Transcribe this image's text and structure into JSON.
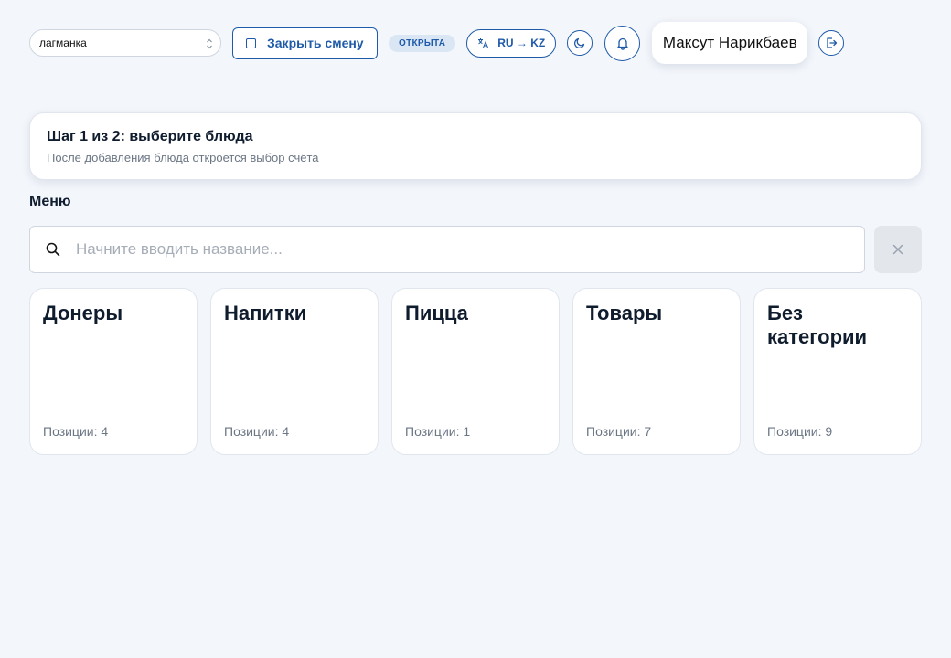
{
  "topbar": {
    "location_select": "лагманка",
    "close_shift_label": "Закрыть смену",
    "shift_status": "ОТКРЫТА",
    "language_label": "RU → KZ",
    "user_name": "Максут Нарикбаев"
  },
  "step": {
    "title": "Шаг 1 из 2: выберите блюда",
    "subtitle": "После добавления блюда откроется выбор счёта"
  },
  "menu": {
    "heading": "Меню",
    "search_placeholder": "Начните вводить название...",
    "categories": [
      {
        "name": "Донеры",
        "count_label": "Позиции: 4"
      },
      {
        "name": "Напитки",
        "count_label": "Позиции: 4"
      },
      {
        "name": "Пицца",
        "count_label": "Позиции: 1"
      },
      {
        "name": "Товары",
        "count_label": "Позиции: 7"
      },
      {
        "name": "Без категории",
        "count_label": "Позиции: 9"
      }
    ]
  },
  "colors": {
    "accent": "#1e5aa8",
    "background": "#f3f6fb",
    "badge_bg": "#dbe6f5"
  },
  "icons": {
    "select_chevron": "chevron-updown-icon",
    "close_shift": "square-icon",
    "language": "translate-icon",
    "theme": "moon-icon",
    "notifications": "bell-icon",
    "logout": "logout-icon",
    "search": "search-icon",
    "clear": "close-icon"
  }
}
